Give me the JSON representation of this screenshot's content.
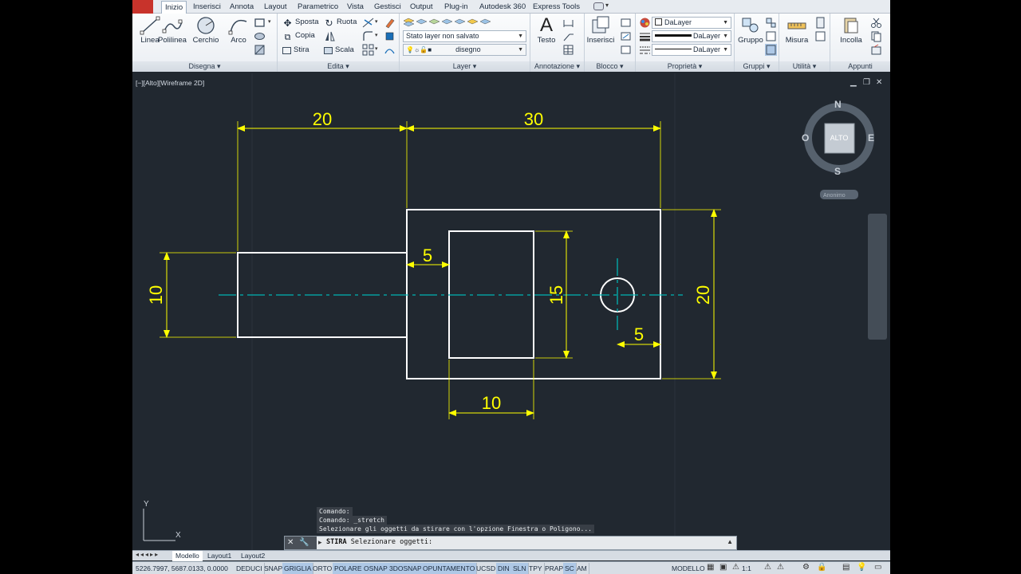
{
  "tabs": [
    "Inizio",
    "Inserisci",
    "Annota",
    "Layout",
    "Parametrico",
    "Vista",
    "Gestisci",
    "Output",
    "Plug-in",
    "Autodesk 360",
    "Express Tools"
  ],
  "ribbon": {
    "disegna": {
      "title": "Disegna",
      "linea": "Linea",
      "polilinea": "Polilinea",
      "cerchio": "Cerchio",
      "arco": "Arco"
    },
    "edita": {
      "title": "Edita",
      "sposta": "Sposta",
      "ruota": "Ruota",
      "copia": "Copia",
      "stira": "Stira",
      "scala": "Scala"
    },
    "layer": {
      "title": "Layer",
      "stato": "Stato layer non salvato",
      "current": "disegno"
    },
    "annotazione": {
      "title": "Annotazione",
      "testo": "Testo"
    },
    "blocco": {
      "title": "Blocco",
      "inserisci": "Inserisci"
    },
    "proprieta": {
      "title": "Proprietà",
      "color": "DaLayer",
      "linetype": "DaLayer",
      "lineweight": "DaLayer"
    },
    "gruppi": {
      "title": "Gruppi",
      "gruppo": "Gruppo"
    },
    "utilita": {
      "title": "Utilità",
      "misura": "Misura"
    },
    "appunti": {
      "title": "Appunti",
      "incolla": "Incolla"
    }
  },
  "viewport": {
    "label": "[−][Alto][Wireframe 2D]",
    "compass": {
      "n": "N",
      "s": "S",
      "e": "E",
      "w": "O",
      "center": "ALTO"
    },
    "ucs_menu": "Anonimo",
    "ucs": {
      "x": "X",
      "y": "Y"
    },
    "dimensions": {
      "d20_top": "20",
      "d30_top": "30",
      "d10_left": "10",
      "d5_mid": "5",
      "d15": "15",
      "d20_right": "20",
      "d5_hole": "5",
      "d10_bottom": "10"
    }
  },
  "command": {
    "history": [
      "Comando:",
      "Comando: _stretch",
      "Selezionare gli oggetti da stirare con l'opzione Finestra o Poligono..."
    ],
    "prompt_cmd": "STIRA",
    "prompt_text": "Selezionare oggetti:"
  },
  "layout_tabs": [
    "Modello",
    "Layout1",
    "Layout2"
  ],
  "status": {
    "coords": "5226.7997, 5687.0133, 0.0000",
    "toggles": [
      "DEDUCI",
      "SNAP",
      "GRIGLIA",
      "ORTO",
      "POLARE",
      "OSNAP",
      "3DOSNAP",
      "OPUNTAMENTO",
      "UCSD",
      "DIN",
      "SLN",
      "TPY",
      "PRAP",
      "SC",
      "AM"
    ],
    "active": [
      "GRIGLIA",
      "POLARE",
      "OSNAP",
      "3DOSNAP",
      "OPUNTAMENTO",
      "DIN",
      "SLN",
      "SC"
    ],
    "modello": "MODELLO",
    "scale": "1:1"
  },
  "colors": {
    "background": "#212830",
    "geometry": "#ffffff",
    "dimension": "#ffff00",
    "centerline": "#00b3b3"
  }
}
